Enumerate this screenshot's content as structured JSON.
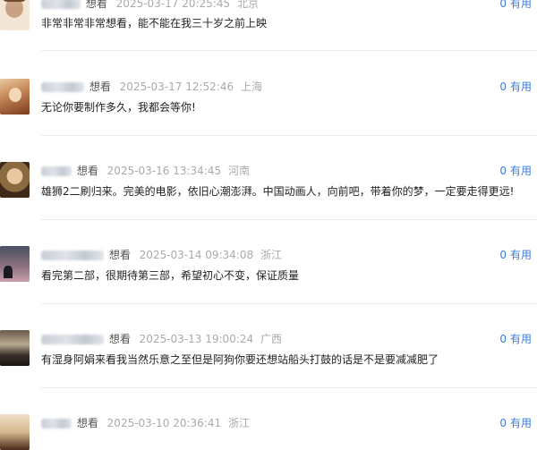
{
  "comments": [
    {
      "status": "想看",
      "time": "2025-03-17 20:25:45",
      "location": "北京",
      "useful_count": "0",
      "useful_label": "有用",
      "text": "非常非常非常想看，能不能在我三十岁之前上映",
      "avatar_colors": [
        "#f4e6d6",
        "#6b4a2e",
        "#c8a383"
      ]
    },
    {
      "status": "想看",
      "time": "2025-03-17 12:52:46",
      "location": "上海",
      "useful_count": "0",
      "useful_label": "有用",
      "text": "无论你要制作多久，我都会等你!",
      "avatar_colors": [
        "#7a3b1e",
        "#c98a5a",
        "#e8c9a0"
      ]
    },
    {
      "status": "想看",
      "time": "2025-03-16 13:34:45",
      "location": "河南",
      "useful_count": "0",
      "useful_label": "有用",
      "text": "雄狮2二刷归来。完美的电影，依旧心潮澎湃。中国动画人，向前吧，带着你的梦，一定要走得更远!",
      "avatar_colors": [
        "#3f2a1a",
        "#d9b08a",
        "#8a6a3e"
      ]
    },
    {
      "status": "想看",
      "time": "2025-03-14 09:34:08",
      "location": "浙江",
      "useful_count": "0",
      "useful_label": "有用",
      "text": "看完第二部，很期待第三部，希望初心不变，保证质量",
      "avatar_colors": [
        "#2b2f3a",
        "#8a7080",
        "#c9a0a8"
      ]
    },
    {
      "status": "想看",
      "time": "2025-03-13 19:00:24",
      "location": "广西",
      "useful_count": "0",
      "useful_label": "有用",
      "text": "有湿身阿娟来看我当然乐意之至但是阿狗你要还想站船头打鼓的话是不是要减减肥了",
      "avatar_colors": [
        "#1a1410",
        "#6b5a4a",
        "#b8a890"
      ]
    },
    {
      "status": "想看",
      "time": "2025-03-10 20:36:41",
      "location": "浙江",
      "useful_count": "0",
      "useful_label": "有用",
      "text": "",
      "avatar_colors": [
        "#4a2a1a",
        "#d6b890",
        "#f0e0c8"
      ]
    }
  ]
}
